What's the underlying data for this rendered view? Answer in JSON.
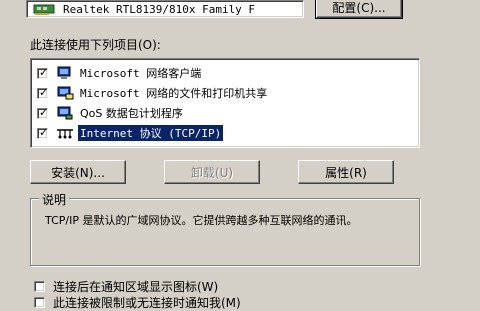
{
  "adapter": {
    "name": "Realtek RTL8139/810x Family F",
    "configure_label": "配置(C)..."
  },
  "components": {
    "label": "此连接使用下列项目(O):",
    "items": [
      {
        "label": "Microsoft 网络客户端",
        "checked": true,
        "selected": false,
        "icon": "network-client-icon"
      },
      {
        "label": "Microsoft 网络的文件和打印机共享",
        "checked": true,
        "selected": false,
        "icon": "file-share-icon"
      },
      {
        "label": "QoS 数据包计划程序",
        "checked": true,
        "selected": false,
        "icon": "qos-icon"
      },
      {
        "label": "Internet 协议 (TCP/IP)",
        "checked": true,
        "selected": true,
        "icon": "protocol-icon"
      }
    ]
  },
  "buttons": {
    "install": "安装(N)...",
    "uninstall": "卸载(U)",
    "properties": "属性(R)"
  },
  "description": {
    "title": "说明",
    "text": "TCP/IP 是默认的广域网协议。它提供跨越多种互联网络的通讯。"
  },
  "options": {
    "show_icon": "连接后在通知区域显示图标(W)",
    "notify_limited": "此连接被限制或无连接时通知我(M)"
  },
  "colors": {
    "dialog_bg": "#d4d0c8",
    "selection": "#0a246a"
  }
}
